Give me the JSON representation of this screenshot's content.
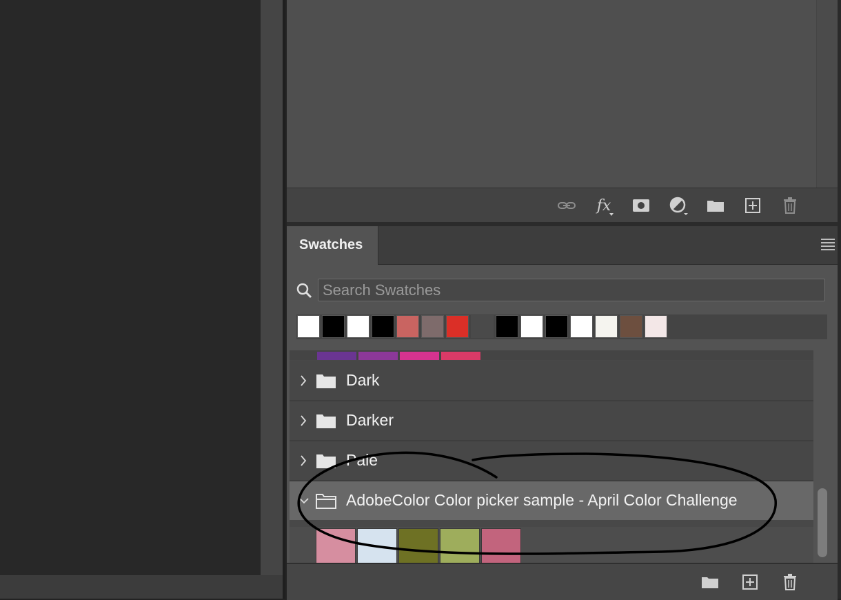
{
  "layers_footer": {
    "icons": [
      "link-icon",
      "fx-icon",
      "mask-icon",
      "adjustment-icon",
      "folder-icon",
      "new-layer-icon",
      "trash-icon"
    ],
    "fx_label": "fx"
  },
  "swatches": {
    "tab_label": "Swatches",
    "search": {
      "placeholder": "Search Swatches",
      "value": ""
    },
    "recent_colors": [
      "#ffffff",
      "#000000",
      "#ffffff",
      "#000000",
      "#c96461",
      "#7e6b6b",
      "#db2f27",
      "#4a4a4a",
      "#000000",
      "#ffffff",
      "#000000",
      "#ffffff",
      "#f5f4ef",
      "#6d4f3f",
      "#f3e7e7"
    ],
    "partial_colors": [
      "#6a3592",
      "#8c3899",
      "#d5338f",
      "#da3a67"
    ],
    "groups": [
      {
        "label": "Dark",
        "expanded": false
      },
      {
        "label": "Darker",
        "expanded": false
      },
      {
        "label": "Pale",
        "expanded": false
      },
      {
        "label": "AdobeColor Color picker sample - April Color Challenge",
        "expanded": true
      }
    ],
    "expanded_colors": [
      "#d68ea0",
      "#d6e3ef",
      "#6e7124",
      "#9ead5c",
      "#c2647d"
    ],
    "footer_icons": [
      "new-group-folder-icon",
      "new-swatch-icon",
      "delete-swatch-icon"
    ]
  },
  "colors": {
    "panel_bg": "#535353",
    "selected_row": "#686868",
    "annotation_ink": "#000000"
  }
}
